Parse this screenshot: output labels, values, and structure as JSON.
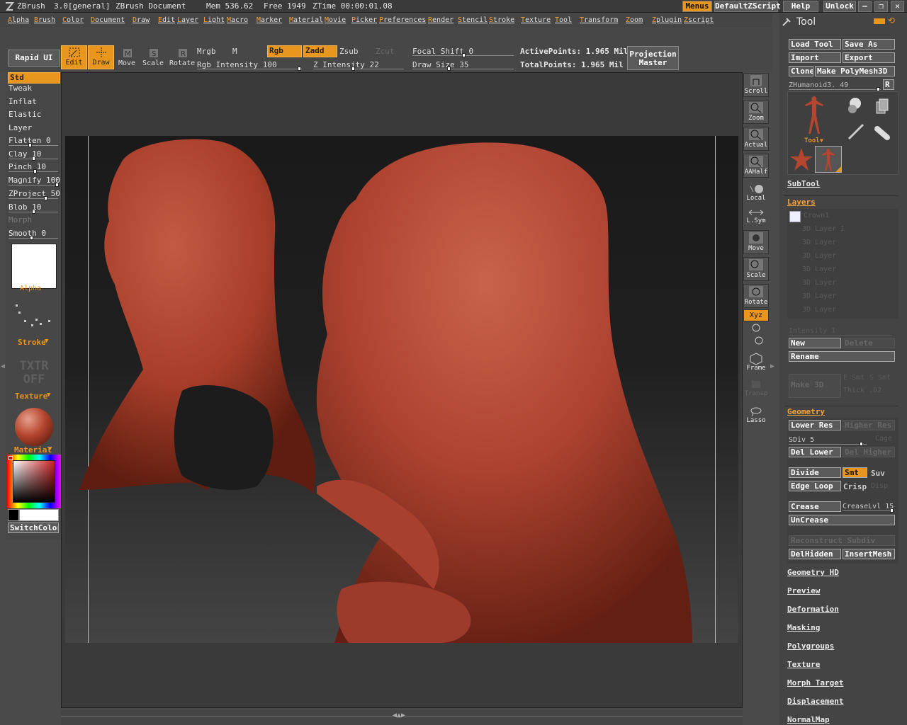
{
  "title": {
    "app": "ZBrush",
    "version": "3.0[general]",
    "doc": "ZBrush Document",
    "mem": "Mem 536.62",
    "free": "Free 1949",
    "ztime": "ZTime 00:00:01.08"
  },
  "title_buttons": {
    "menus": "Menus",
    "script": "DefaultZScript",
    "help": "Help",
    "unlock": "Unlock"
  },
  "menus": [
    "Alpha",
    "Brush",
    "Color",
    "Document",
    "Draw",
    "Edit",
    "Layer",
    "Light",
    "Macro",
    "Marker",
    "Material",
    "Movie",
    "Picker",
    "Preferences",
    "Render",
    "Stencil",
    "Stroke",
    "Texture",
    "Tool",
    "Transform",
    "Zoom",
    "Zplugin",
    "Zscript"
  ],
  "top": {
    "rapid_ui": "Rapid UI",
    "edit": "Edit",
    "draw": "Draw",
    "move": "Move",
    "scale": "Scale",
    "rotate": "Rotate",
    "mrgb": "Mrgb",
    "m": "M",
    "rgb": "Rgb",
    "zadd": "Zadd",
    "zsub": "Zsub",
    "zcut": "Zcut",
    "rgb_intensity": "Rgb Intensity 100",
    "z_intensity": "Z Intensity 22",
    "focal_shift": "Focal Shift 0",
    "draw_size": "Draw Size 35",
    "active_points": "ActivePoints: 1.965 Mil",
    "total_points": "TotalPoints: 1.965 Mil",
    "projection_master": [
      "Projection",
      "Master"
    ]
  },
  "left": {
    "brushes": [
      "Std",
      "Tweak",
      "Inflat",
      "Elastic",
      "Layer"
    ],
    "sliders": [
      {
        "label": "Flatten 0",
        "value": 0
      },
      {
        "label": "Clay 10",
        "value": 10
      },
      {
        "label": "Pinch 10",
        "value": 10
      },
      {
        "label": "Magnify 100",
        "value": 100
      },
      {
        "label": "ZProject 50",
        "value": 50
      },
      {
        "label": "Blob 10",
        "value": 10
      },
      {
        "label": "Morph",
        "value": null
      },
      {
        "label": "Smooth 0",
        "value": 0
      }
    ],
    "alpha": "Alpha",
    "stroke": "Stroke",
    "txtr1": "TXTR",
    "txtr2": "OFF",
    "texture": "Texture",
    "material": "Material",
    "switch_color": "SwitchColor",
    "material_color": "#b5452e"
  },
  "right_shelf": [
    "Scroll",
    "Zoom",
    "Actual",
    "AAHalf",
    "Local",
    "L.Sym",
    "Move",
    "Scale",
    "Rotate",
    "Xyz",
    "Frame",
    "Transp",
    "Lasso"
  ],
  "tray": {
    "title": "Tool",
    "load_tool": "Load Tool",
    "save_as": "Save As",
    "import": "Import",
    "export": "Export",
    "clone": "Clone",
    "make_polymesh": "Make PolyMesh3D",
    "tool_name": "ZHumanoid3. 49",
    "r": "R",
    "tool_caption": "Tool",
    "subtool": "SubTool",
    "layers": "Layers",
    "layer_items": [
      "Crown1",
      "3D Layer 1",
      "3D Layer",
      "3D Layer",
      "3D Layer",
      "3D Layer",
      "3D Layer",
      "3D Layer"
    ],
    "intensity": "Intensity 1",
    "new": "New",
    "delete": "Delete",
    "rename": "Rename",
    "make3d": "Make 3D",
    "esmt": "E Smt",
    "smt": "S Smt",
    "thick": "Thick .02",
    "geometry": "Geometry",
    "lower_res": "Lower Res",
    "higher_res": "Higher Res",
    "sdiv": "SDiv 5",
    "cage": "Cage",
    "del_lower": "Del Lower",
    "del_higher": "Del Higher",
    "divide": "Divide",
    "smt_btn": "Smt",
    "suv": "Suv",
    "edge_loop": "Edge Loop",
    "crisp": "Crisp",
    "disp": "Disp",
    "crease": "Crease",
    "crease_lvl": "CreaseLvl 15",
    "uncrease": "UnCrease",
    "reconstruct": "Reconstruct Subdiv",
    "delhidden": "DelHidden",
    "insertmesh": "InsertMesh",
    "sections": [
      "Geometry HD",
      "Preview",
      "Deformation",
      "Masking",
      "Polygroups",
      "Texture",
      "Morph Target",
      "Displacement",
      "NormalMap"
    ]
  },
  "colors": {
    "accent": "#e8961e",
    "clay": "#b5452e"
  }
}
